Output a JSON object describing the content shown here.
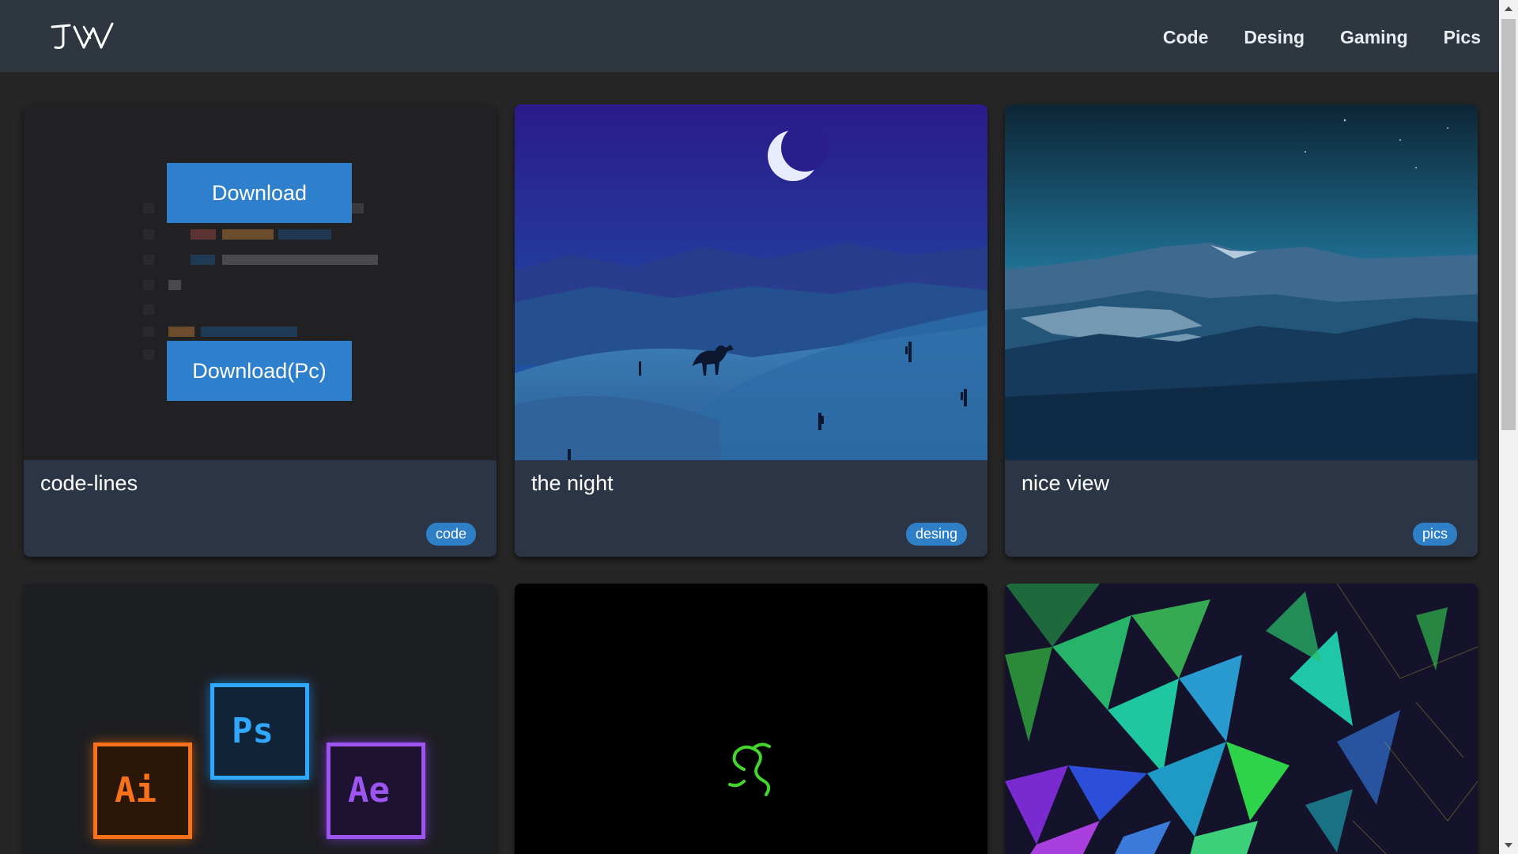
{
  "header": {
    "logo_text": "JW",
    "nav": [
      "Code",
      "Desing",
      "Gaming",
      "Pics"
    ]
  },
  "cards": [
    {
      "title": "code-lines",
      "tag": "code",
      "buttons": {
        "download": "Download",
        "download_pc": "Download(Pc)"
      }
    },
    {
      "title": "the night",
      "tag": "desing"
    },
    {
      "title": "nice view",
      "tag": "pics"
    },
    {
      "adobe_icons": [
        "Ps",
        "Ai",
        "Ae"
      ]
    },
    {},
    {}
  ],
  "colors": {
    "header_bg": "#2e3640",
    "page_bg": "#262627",
    "card_info_bg": "#2c3546",
    "accent_blue": "#2f80cc",
    "ai_orange": "#f7721a",
    "ps_blue": "#31a8ff",
    "ae_purple": "#9c55f0",
    "razer_green": "#44d62c"
  }
}
